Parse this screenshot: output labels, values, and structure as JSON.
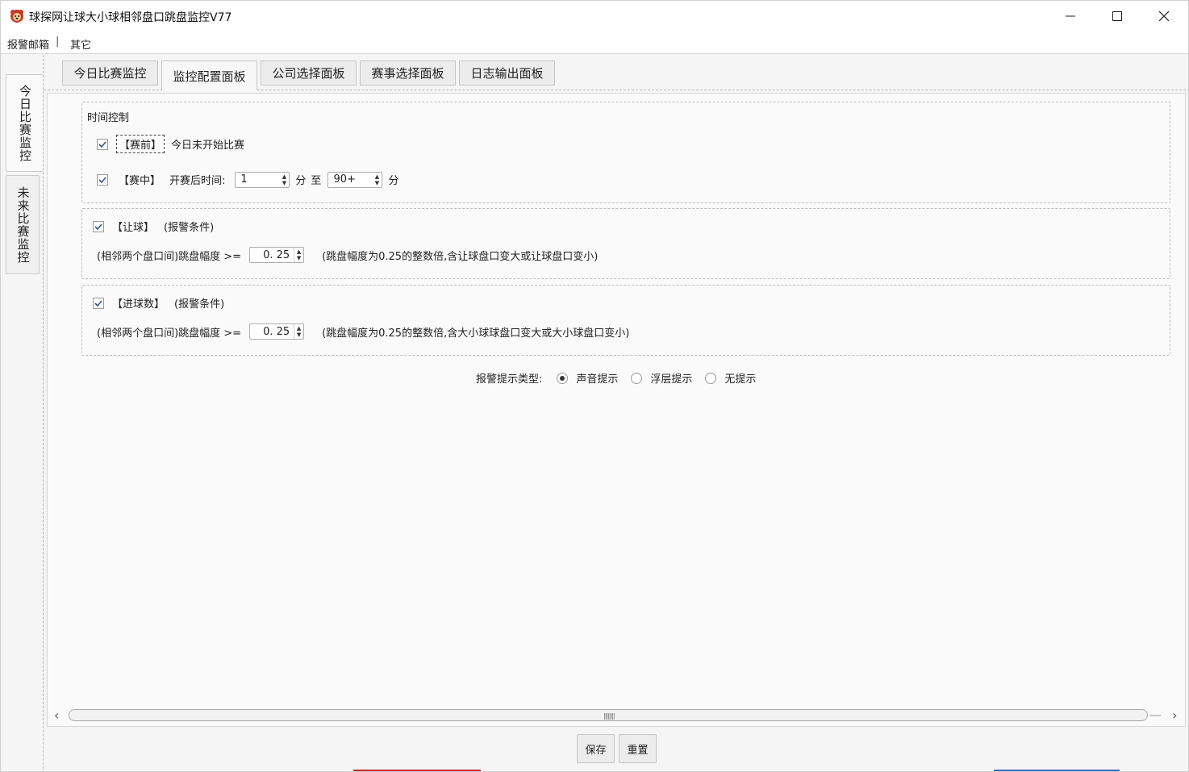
{
  "window": {
    "title": "球探网让球大小球相邻盘口跳盘监控V77",
    "minimize": "—",
    "maximize": "☐",
    "close": "✕"
  },
  "menu": {
    "items": [
      "报警邮箱",
      "其它"
    ],
    "separator": "|"
  },
  "side_tabs": [
    {
      "label": "今日比赛监控",
      "active": true
    },
    {
      "label": "未来比赛监控",
      "active": false
    }
  ],
  "tabs": [
    {
      "label": "今日比赛监控",
      "active": false
    },
    {
      "label": "监控配置面板",
      "active": true
    },
    {
      "label": "公司选择面板",
      "active": false
    },
    {
      "label": "赛事选择面板",
      "active": false
    },
    {
      "label": "日志输出面板",
      "active": false
    }
  ],
  "time_control": {
    "title": "时间控制",
    "pre_match": {
      "checked": true,
      "label": "【赛前】",
      "desc": "今日未开始比赛"
    },
    "in_play": {
      "checked": true,
      "label": "【赛中】",
      "desc": "开赛后时间:",
      "from_value": "1",
      "from_unit": "分",
      "to_text": "至",
      "to_value": "90+",
      "to_unit": "分"
    }
  },
  "handicap": {
    "checked": true,
    "label": "【让球】",
    "cond": "(报警条件)",
    "jump_label": "(相邻两个盘口间)跳盘幅度 >=",
    "value": "0. 25",
    "hint": "(跳盘幅度为0.25的整数倍,含让球盘口变大或让球盘口变小)"
  },
  "goals": {
    "checked": true,
    "label": "【进球数】",
    "cond": "(报警条件)",
    "jump_label": "(相邻两个盘口间)跳盘幅度 >=",
    "value": "0. 25",
    "hint": "(跳盘幅度为0.25的整数倍,含大小球球盘口变大或大小球盘口变小)"
  },
  "alert_type": {
    "label": "报警提示类型:",
    "options": [
      {
        "label": "声音提示",
        "selected": true
      },
      {
        "label": "浮层提示",
        "selected": false
      },
      {
        "label": "无提示",
        "selected": false
      }
    ]
  },
  "buttons": {
    "save": "保存",
    "reset": "重置"
  },
  "icons": {
    "app": "bear-logo-icon",
    "scroll_left": "‹",
    "scroll_right": "›",
    "grip": "||||||||"
  },
  "colors": {
    "checkbox_check": "#2b5797",
    "strip_red": "#c8282a",
    "strip_blue": "#3b6fc8"
  }
}
